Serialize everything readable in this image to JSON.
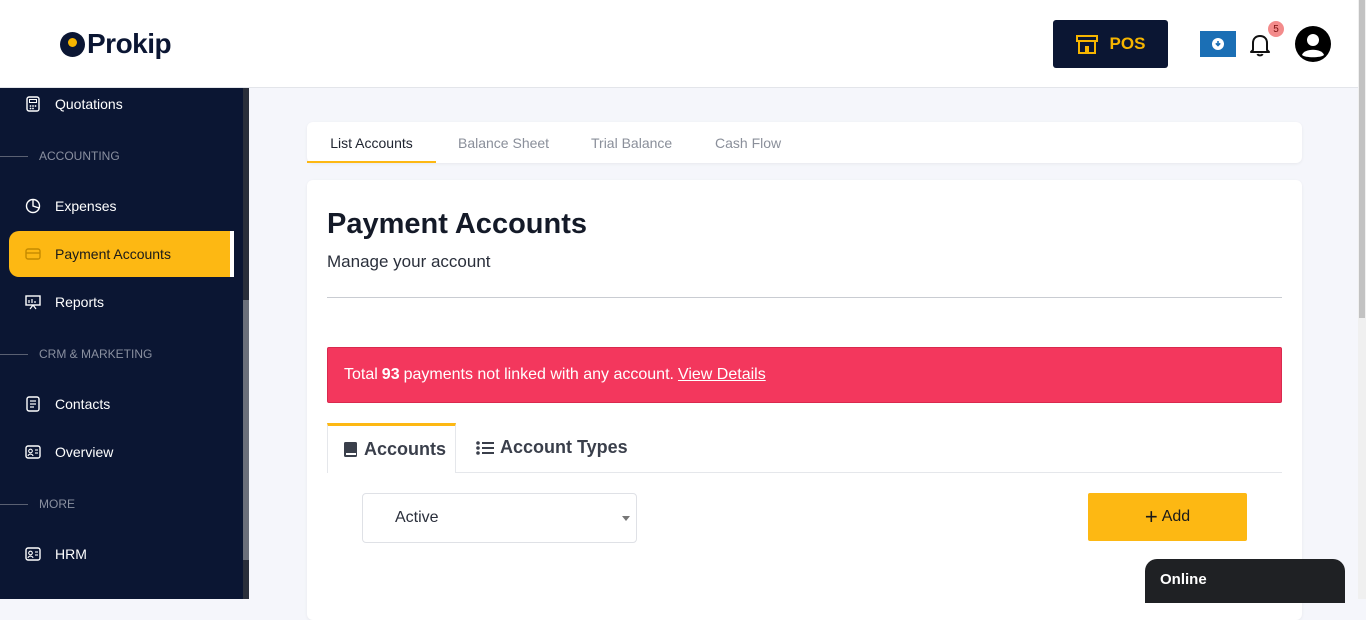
{
  "brand": {
    "name": "Prokip"
  },
  "header": {
    "pos_label": "POS",
    "notification_count": "5"
  },
  "sidebar": {
    "items": [
      {
        "label": "Quotations",
        "icon": "calculator-icon"
      },
      {
        "section": "ACCOUNTING"
      },
      {
        "label": "Expenses",
        "icon": "pie-chart-icon"
      },
      {
        "label": "Payment Accounts",
        "icon": "card-icon",
        "active": true
      },
      {
        "label": "Reports",
        "icon": "presentation-icon"
      },
      {
        "section": "CRM & MARKETING"
      },
      {
        "label": "Contacts",
        "icon": "contacts-icon"
      },
      {
        "label": "Overview",
        "icon": "id-card-icon"
      },
      {
        "section": "MORE"
      },
      {
        "label": "HRM",
        "icon": "id-card-icon"
      }
    ]
  },
  "tabs": [
    "List Accounts",
    "Balance Sheet",
    "Trial Balance",
    "Cash Flow"
  ],
  "main": {
    "title": "Payment Accounts",
    "subtitle": "Manage your account",
    "alert": {
      "prefix": "Total",
      "count": "93",
      "text": "payments not linked with any account.",
      "link": "View Details"
    },
    "subtabs": [
      "Accounts",
      "Account Types"
    ],
    "filter_value": "Active",
    "add_label": "Add"
  },
  "chat": {
    "status": "Online"
  },
  "colors": {
    "accent": "#fdb813",
    "navy": "#0b1633",
    "alert": "#f3375d"
  }
}
